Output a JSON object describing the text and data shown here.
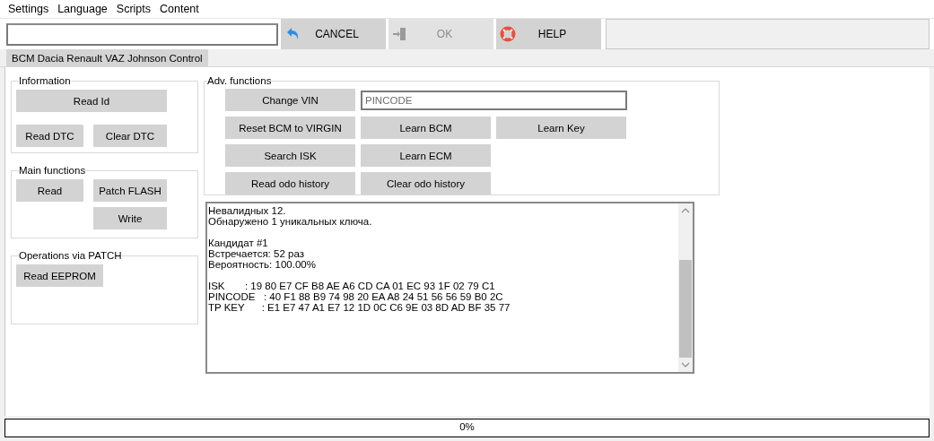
{
  "menu": [
    "Settings",
    "Language",
    "Scripts",
    "Content"
  ],
  "toolbar": {
    "buttons": [
      {
        "label": "CANCEL",
        "disabled": false
      },
      {
        "label": "OK",
        "disabled": true
      },
      {
        "label": "HELP",
        "disabled": false
      }
    ]
  },
  "tabs": [
    {
      "label": "BCM Dacia Renault VAZ Johnson Control",
      "selected": true
    }
  ],
  "groups": [
    {
      "title": "Information",
      "buttons": [
        "Read Id",
        "Read DTC",
        "Clear DTC"
      ]
    },
    {
      "title": "Main functions",
      "buttons": [
        "Read",
        "Patch FLASH",
        "Write"
      ]
    },
    {
      "title": "Operations via PATCH",
      "buttons": [
        "Read EEPROM"
      ]
    }
  ],
  "adv": {
    "title": "Adv. functions",
    "field": {
      "value": "PINCODE"
    },
    "rows": [
      [
        "Change VIN"
      ],
      [
        "Reset BCM to VIRGIN",
        "Learn BCM",
        "Learn Key"
      ],
      [
        "Search ISK",
        "Learn ECM"
      ],
      [
        "Read odo history",
        "Clear odo history"
      ]
    ]
  },
  "log": [
    [
      "Невалидных 12.",
      "Обнаружено 1 уникальных ключа."
    ],
    [
      "Кандидат #1",
      "Встречается: 52 раз",
      "Вероятность: 100.00%"
    ],
    [
      "ISK       : 19 80 E7 CF B8 AE A6 CD CA 01 EC 93 1F 02 79 C1",
      "PINCODE   : 40 F1 88 B9 74 98 20 EA A8 24 51 56 56 59 B0 2C",
      "TP KEY      : E1 E7 47 A1 E7 12 1D 0C C6 9E 03 8D AD BF 35 77"
    ]
  ],
  "progress": {
    "level": 0,
    "reading": "0%"
  }
}
